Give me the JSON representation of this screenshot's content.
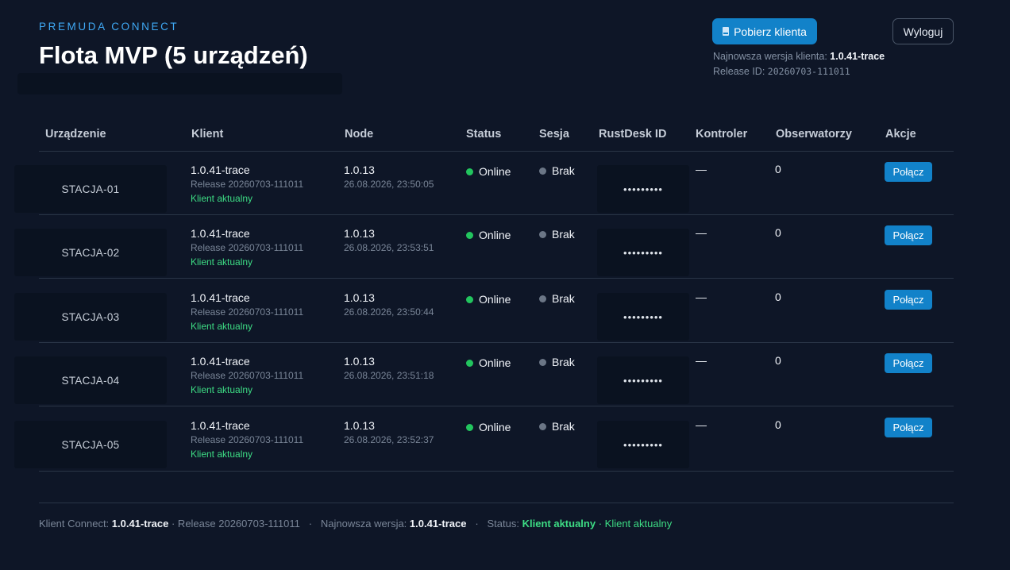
{
  "header": {
    "brand": "PREMUDA CONNECT",
    "title": "Flota MVP (5 urządzeń)",
    "download_button": "Pobierz klienta",
    "logout_button": "Wyloguj",
    "latest_version_label": "Najnowsza wersja klienta:",
    "latest_version_value": "1.0.41-trace",
    "release_label": "Release ID:",
    "release_value": "20260703-111011"
  },
  "table": {
    "columns": [
      "Urządzenie",
      "Klient",
      "Node",
      "Status",
      "Sesja",
      "RustDesk ID",
      "Kontroler",
      "Obserwatorzy",
      "Akcje"
    ],
    "rows": [
      {
        "device": "STACJA-01",
        "client_version": "1.0.41-trace",
        "client_release": "Release 20260703-111011",
        "client_state": "Klient aktualny",
        "node_version": "1.0.13",
        "node_time": "26.08.2026, 23:50:05",
        "status": "Online",
        "session": "Brak",
        "rustdesk_id": "•••••••••",
        "controller": "—",
        "observers": "0",
        "action": "Połącz"
      },
      {
        "device": "STACJA-02",
        "client_version": "1.0.41-trace",
        "client_release": "Release 20260703-111011",
        "client_state": "Klient aktualny",
        "node_version": "1.0.13",
        "node_time": "26.08.2026, 23:53:51",
        "status": "Online",
        "session": "Brak",
        "rustdesk_id": "•••••••••",
        "controller": "—",
        "observers": "0",
        "action": "Połącz"
      },
      {
        "device": "STACJA-03",
        "client_version": "1.0.41-trace",
        "client_release": "Release 20260703-111011",
        "client_state": "Klient aktualny",
        "node_version": "1.0.13",
        "node_time": "26.08.2026, 23:50:44",
        "status": "Online",
        "session": "Brak",
        "rustdesk_id": "•••••••••",
        "controller": "—",
        "observers": "0",
        "action": "Połącz"
      },
      {
        "device": "STACJA-04",
        "client_version": "1.0.41-trace",
        "client_release": "Release 20260703-111011",
        "client_state": "Klient aktualny",
        "node_version": "1.0.13",
        "node_time": "26.08.2026, 23:51:18",
        "status": "Online",
        "session": "Brak",
        "rustdesk_id": "•••••••••",
        "controller": "—",
        "observers": "0",
        "action": "Połącz"
      },
      {
        "device": "STACJA-05",
        "client_version": "1.0.41-trace",
        "client_release": "Release 20260703-111011",
        "client_state": "Klient aktualny",
        "node_version": "1.0.13",
        "node_time": "26.08.2026, 23:52:37",
        "status": "Online",
        "session": "Brak",
        "rustdesk_id": "•••••••••",
        "controller": "—",
        "observers": "0",
        "action": "Połącz"
      }
    ]
  },
  "footer": {
    "client_label": "Klient Connect:",
    "client_value": "1.0.41-trace",
    "release_text": "· Release 20260703-111011",
    "sep1": "·",
    "latest_label": "Najnowsza wersja:",
    "latest_value": "1.0.41-trace",
    "sep2": "·",
    "status_label": "Status:",
    "status_value": "Klient aktualny",
    "status_extra": "· Klient aktualny"
  },
  "colors": {
    "background": "#0e1627",
    "accent": "#1282c9",
    "brand": "#3fa9f5",
    "ok": "#3ddc84",
    "online_dot": "#22c55e"
  },
  "icons": {
    "download_button_icon": "file-download-icon"
  }
}
